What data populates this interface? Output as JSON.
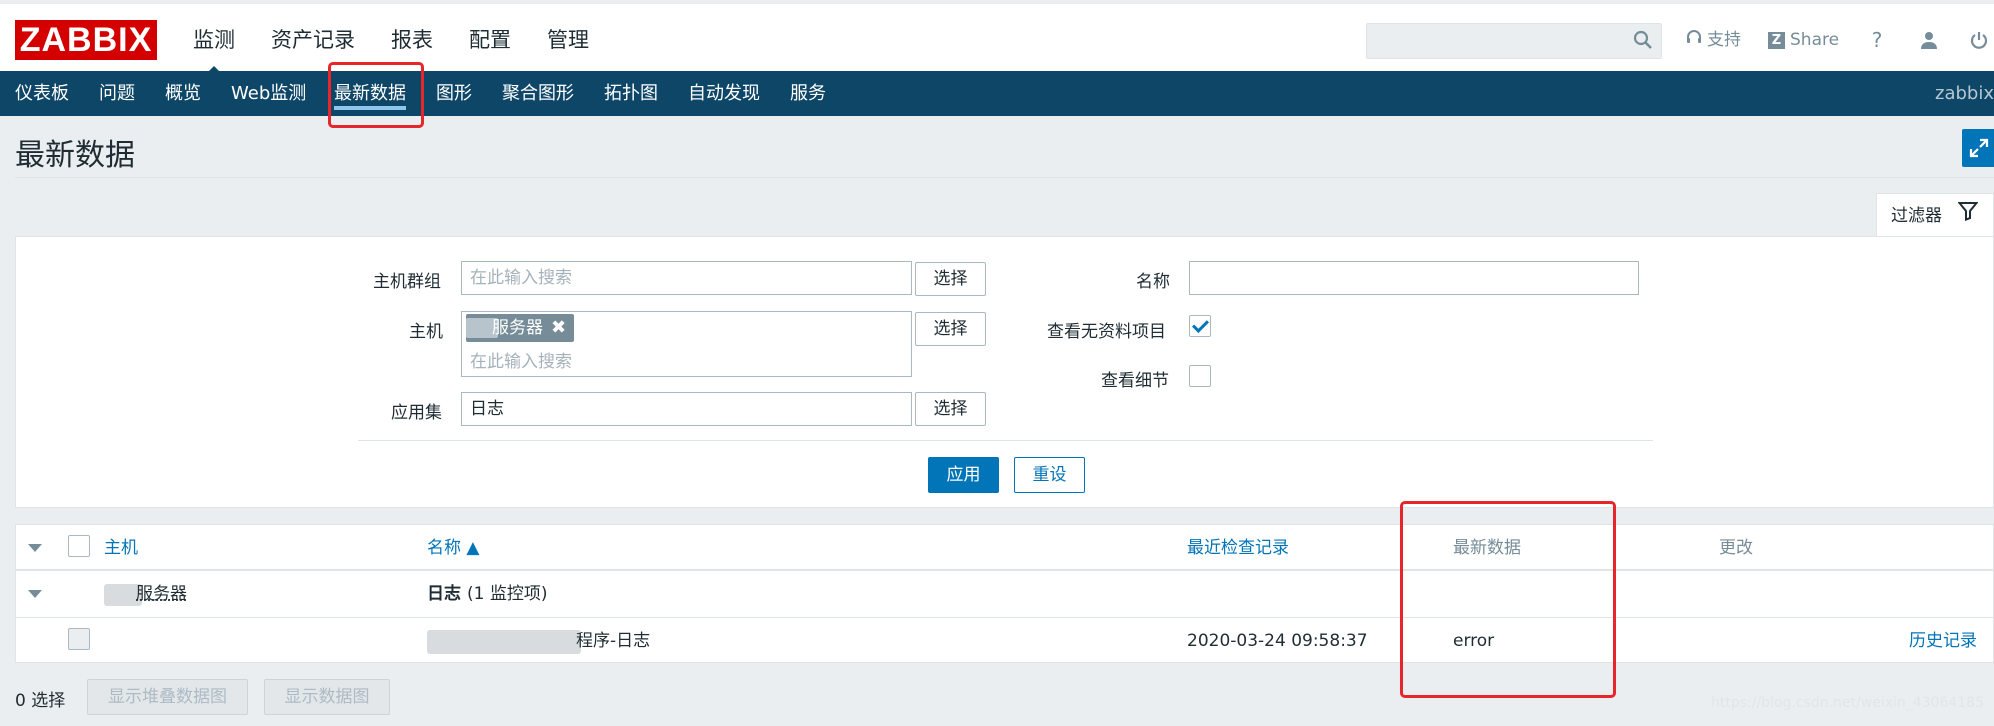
{
  "header": {
    "logo": "ZABBIX",
    "menu": [
      "监测",
      "资产记录",
      "报表",
      "配置",
      "管理"
    ],
    "support": "支持",
    "share": "Share",
    "help": "?"
  },
  "subnav": {
    "items": [
      "仪表板",
      "问题",
      "概览",
      "Web监测",
      "最新数据",
      "图形",
      "聚合图形",
      "拓扑图",
      "自动发现",
      "服务"
    ],
    "active": "最新数据",
    "user": "zabbix"
  },
  "page": {
    "title": "最新数据"
  },
  "filter": {
    "tab_label": "过滤器",
    "host_group_label": "主机群组",
    "host_group_placeholder": "在此输入搜索",
    "host_label": "主机",
    "host_chip": "服务器",
    "host_placeholder": "在此输入搜索",
    "app_label": "应用集",
    "app_value": "日志",
    "select_label": "选择",
    "name_label": "名称",
    "name_value": "",
    "show_no_data_label": "查看无资料项目",
    "show_no_data_checked": true,
    "show_details_label": "查看细节",
    "show_details_checked": false,
    "apply": "应用",
    "reset": "重设"
  },
  "table": {
    "headers": {
      "host": "主机",
      "name": "名称 ▲",
      "last_check": "最近检查记录",
      "last_value": "最新数据",
      "change": "更改"
    },
    "group_host": "服务器",
    "group_app": "日志",
    "group_count": "(1 监控项)",
    "rows": [
      {
        "name": "程序-日志",
        "last_check": "2020-03-24 09:58:37",
        "last_value": "error",
        "history": "历史记录"
      }
    ]
  },
  "footer": {
    "selected": "0 选择",
    "btn_stacked": "显示堆叠数据图",
    "btn_graph": "显示数据图"
  },
  "watermark": "https://blog.csdn.net/weixin_43064185"
}
